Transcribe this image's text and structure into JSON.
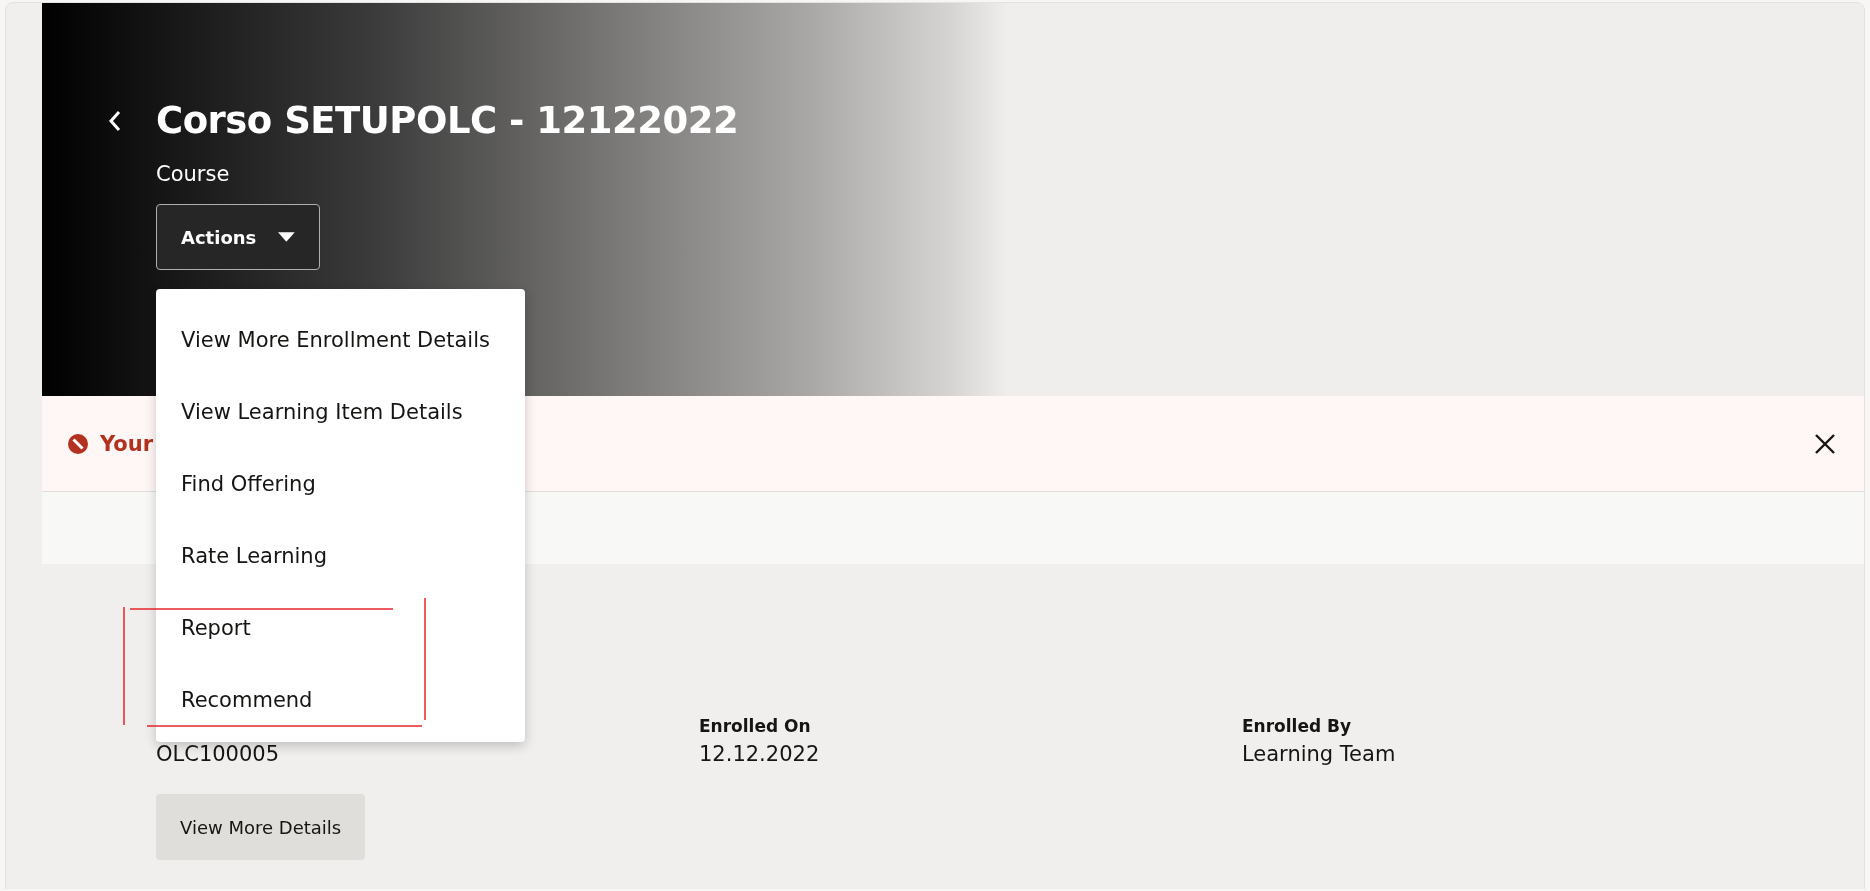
{
  "header": {
    "title": "Corso SETUPOLC - 12122022",
    "subtitle": "Course",
    "actions_button": {
      "label": "Actions",
      "expanded": true
    }
  },
  "actions_menu": {
    "items": [
      {
        "label": "View More Enrollment Details"
      },
      {
        "label": "View Learning Item Details"
      },
      {
        "label": "Find Offering"
      },
      {
        "label": "Rate Learning"
      },
      {
        "label": "Report"
      },
      {
        "label": "Recommend"
      }
    ]
  },
  "alert": {
    "message": "Your"
  },
  "details": [
    {
      "value": "OLC100005"
    },
    {
      "label": "Enrolled On",
      "value": "12.12.2022"
    },
    {
      "label": "Enrolled By",
      "value": "Learning Team"
    }
  ],
  "buttons": [
    "View More Details"
  ]
}
